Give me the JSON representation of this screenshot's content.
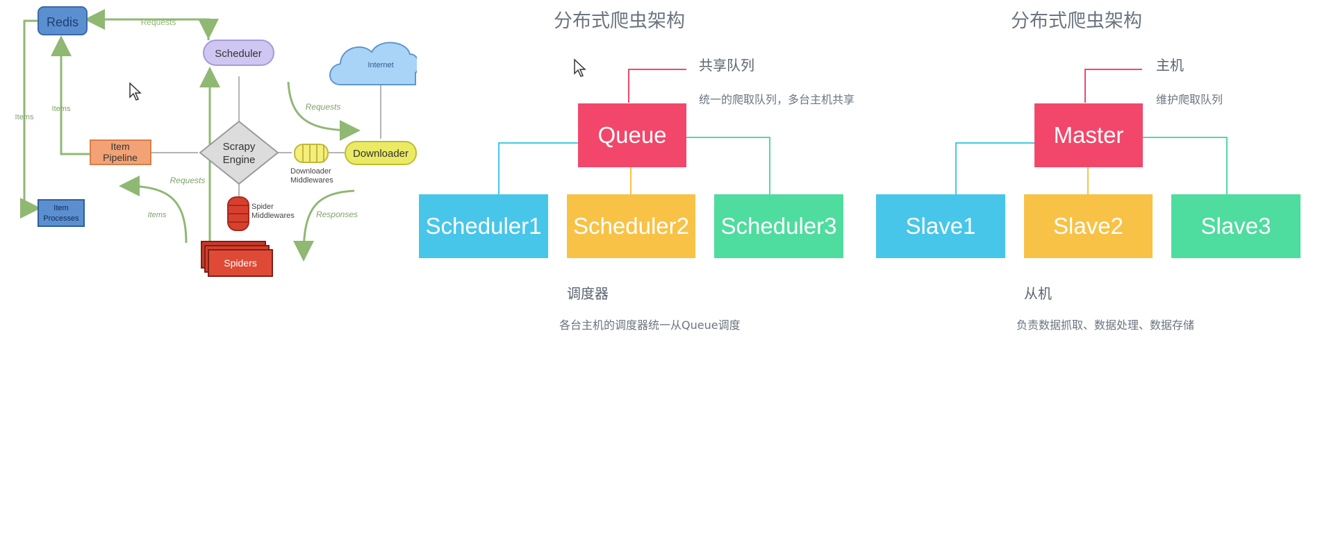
{
  "scrapy": {
    "redis": "Redis",
    "scheduler": "Scheduler",
    "internet": "Internet",
    "requests_top": "Requests",
    "items_left": "Items",
    "items_mid": "Items",
    "requests_right": "Requests",
    "item_pipeline": [
      "Item",
      "Pipeline"
    ],
    "scrapy_engine": [
      "Scrapy",
      "Engine"
    ],
    "downloader": "Downloader",
    "downloader_mw": [
      "Downloader",
      "Middlewares"
    ],
    "requests_low": "Requests",
    "item_processes": [
      "Item",
      "Processes"
    ],
    "items_low": "Items",
    "spider_mw": [
      "Spider",
      "Middlewares"
    ],
    "responses": "Responses",
    "spiders": "Spiders"
  },
  "queue_diagram": {
    "title": "分布式爬虫架构",
    "queue": "Queue",
    "top_label": "共享队列",
    "top_desc": "统一的爬取队列，多台主机共享",
    "children": [
      "Scheduler1",
      "Scheduler2",
      "Scheduler3"
    ],
    "bottom_label": "调度器",
    "bottom_desc": "各台主机的调度器统一从Queue调度"
  },
  "master_diagram": {
    "title": "分布式爬虫架构",
    "master": "Master",
    "top_label": "主机",
    "top_desc": "维护爬取队列",
    "children": [
      "Slave1",
      "Slave2",
      "Slave3"
    ],
    "bottom_label": "从机",
    "bottom_desc": "负责数据抓取、数据处理、数据存储"
  },
  "colors": {
    "red": "#f2476a",
    "blue": "#47c6ea",
    "yellow": "#f8c246",
    "green": "#4fdc9f",
    "arrow": "#8fb873"
  }
}
